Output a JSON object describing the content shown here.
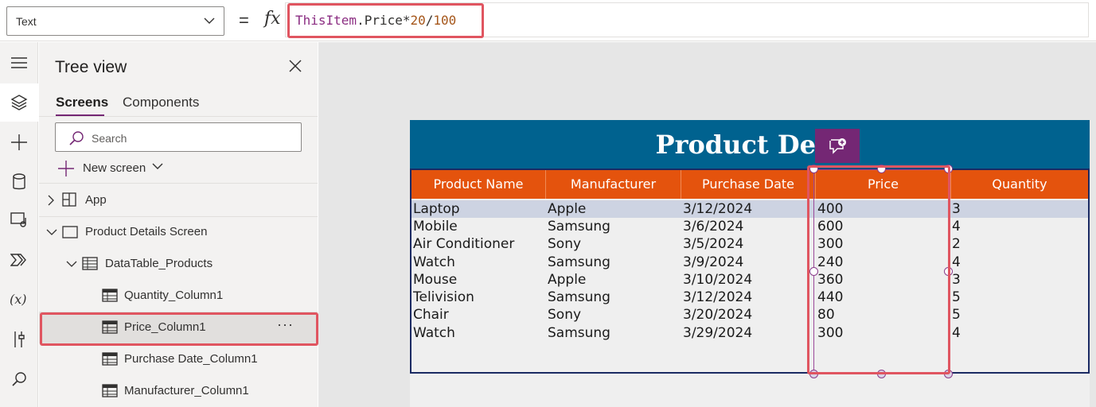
{
  "formula_bar": {
    "property": "Text",
    "formula_tokens": [
      {
        "text": "ThisItem",
        "kind": "obj"
      },
      {
        "text": ".Price*",
        "kind": "op"
      },
      {
        "text": "20",
        "kind": "num"
      },
      {
        "text": "/",
        "kind": "op"
      },
      {
        "text": "100",
        "kind": "num"
      }
    ],
    "equals": "=",
    "fx": "fx"
  },
  "rail": {
    "items": [
      "hamburger-icon",
      "layers-icon",
      "plus-icon",
      "database-icon",
      "media-icon",
      "power-automate-icon",
      "variables-icon",
      "tools-icon",
      "search-icon"
    ]
  },
  "tree_view": {
    "title": "Tree view",
    "tabs": [
      "Screens",
      "Components"
    ],
    "search_placeholder": "Search",
    "new_screen_label": "New screen",
    "items": [
      {
        "label": "App",
        "icon": "app-icon"
      },
      {
        "label": "Product Details Screen",
        "icon": "screen-icon"
      },
      {
        "label": "DataTable_Products",
        "icon": "datatable-icon"
      },
      {
        "label": "Quantity_Column1",
        "icon": "column-icon"
      },
      {
        "label": "Price_Column1",
        "icon": "column-icon",
        "selected": true
      },
      {
        "label": "Purchase Date_Column1",
        "icon": "column-icon"
      },
      {
        "label": "Manufacturer_Column1",
        "icon": "column-icon"
      }
    ],
    "more_label": "···"
  },
  "screen": {
    "title": "Product Deta",
    "columns": [
      "Product Name",
      "Manufacturer",
      "Purchase Date",
      "Price",
      "Quantity"
    ],
    "rows": [
      [
        "Laptop",
        "Apple",
        "3/12/2024",
        "400",
        "3"
      ],
      [
        "Mobile",
        "Samsung",
        "3/6/2024",
        "600",
        "4"
      ],
      [
        "Air Conditioner",
        "Sony",
        "3/5/2024",
        "300",
        "2"
      ],
      [
        "Watch",
        "Samsung",
        "3/9/2024",
        "240",
        "4"
      ],
      [
        "Mouse",
        "Apple",
        "3/10/2024",
        "360",
        "3"
      ],
      [
        "Telivision",
        "Samsung",
        "3/12/2024",
        "440",
        "5"
      ],
      [
        "Chair",
        "Sony",
        "3/20/2024",
        "80",
        "5"
      ],
      [
        "Watch",
        "Samsung",
        "3/29/2024",
        "300",
        "4"
      ]
    ]
  },
  "colors": {
    "header_blue": "#00628f",
    "table_header_orange": "#e4530d",
    "accent_purple": "#742774",
    "highlight_red": "#e05560"
  }
}
